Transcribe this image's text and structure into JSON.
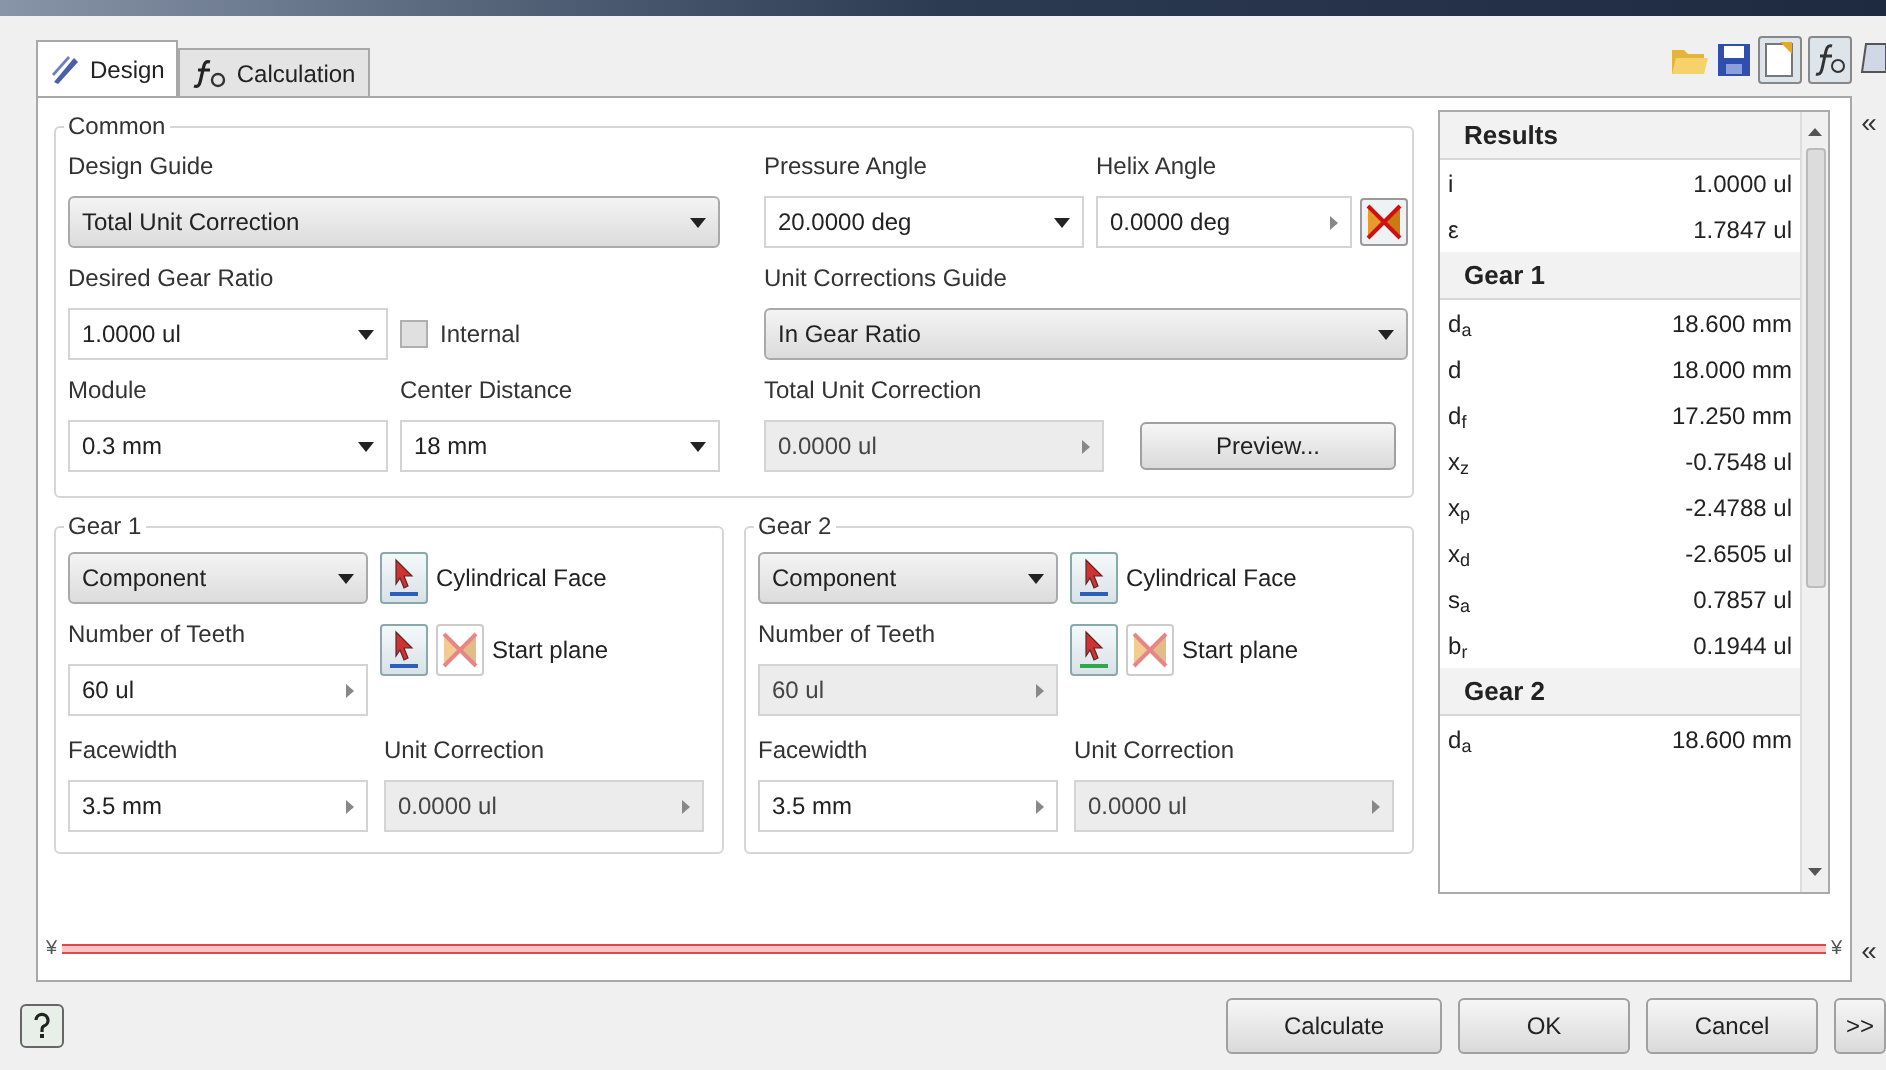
{
  "tabs": [
    {
      "label": "Design",
      "selected": true,
      "kind": "design"
    },
    {
      "label": "Calculation",
      "selected": false,
      "kind": "calc"
    }
  ],
  "common": {
    "title": "Common",
    "design_guide": {
      "label": "Design Guide",
      "value": "Total Unit Correction",
      "kind": "combo"
    },
    "desired_gear_ratio": {
      "label": "Desired Gear Ratio",
      "value": "1.0000 ul",
      "kind": "dropdown"
    },
    "internal": {
      "label": "Internal",
      "checked": false
    },
    "module": {
      "label": "Module",
      "value": "0.3 mm",
      "kind": "dropdown"
    },
    "center_distance": {
      "label": "Center Distance",
      "value": "18 mm",
      "kind": "dropdown"
    },
    "pressure_angle": {
      "label": "Pressure Angle",
      "value": "20.0000 deg",
      "kind": "dropdown"
    },
    "helix_angle": {
      "label": "Helix Angle",
      "value": "0.0000 deg",
      "kind": "spinner",
      "disabled": false
    },
    "unit_corrections_guide": {
      "label": "Unit Corrections Guide",
      "value": "In Gear Ratio",
      "kind": "combo"
    },
    "total_unit_correction": {
      "label": "Total Unit Correction",
      "value": "0.0000 ul",
      "kind": "spinner",
      "disabled": true
    },
    "preview_button": "Preview..."
  },
  "gears": [
    {
      "title": "Gear 1",
      "component": {
        "value": "Component",
        "kind": "combo"
      },
      "cylindrical_face": "Cylindrical Face",
      "start_plane": "Start plane",
      "number_of_teeth": {
        "label": "Number of Teeth",
        "value": "60 ul",
        "kind": "spinner",
        "disabled": false
      },
      "facewidth": {
        "label": "Facewidth",
        "value": "3.5 mm",
        "kind": "spinner",
        "disabled": false
      },
      "unit_correction": {
        "label": "Unit Correction",
        "value": "0.0000 ul",
        "kind": "spinner",
        "disabled": true
      }
    },
    {
      "title": "Gear 2",
      "component": {
        "value": "Component",
        "kind": "combo"
      },
      "cylindrical_face": "Cylindrical Face",
      "start_plane": "Start plane",
      "number_of_teeth": {
        "label": "Number of Teeth",
        "value": "60 ul",
        "kind": "spinner",
        "disabled": true
      },
      "facewidth": {
        "label": "Facewidth",
        "value": "3.5 mm",
        "kind": "spinner",
        "disabled": false
      },
      "unit_correction": {
        "label": "Unit Correction",
        "value": "0.0000 ul",
        "kind": "spinner",
        "disabled": true
      }
    }
  ],
  "results": {
    "title": "Results",
    "rows": [
      {
        "kind": "value",
        "symbol": "i",
        "value": "1.0000 ul"
      },
      {
        "kind": "value",
        "symbol": "ε",
        "value": "1.7847 ul"
      },
      {
        "kind": "header",
        "label": "Gear 1"
      },
      {
        "kind": "value",
        "symbol": "d$_{a}$",
        "value": "18.600 mm"
      },
      {
        "kind": "value",
        "symbol": "d",
        "value": "18.000 mm"
      },
      {
        "kind": "value",
        "symbol": "d$_{f}$",
        "value": "17.250 mm"
      },
      {
        "kind": "value",
        "symbol": "x$_{z}$",
        "value": "-0.7548 ul"
      },
      {
        "kind": "value",
        "symbol": "x$_{p}$",
        "value": "-2.4788 ul"
      },
      {
        "kind": "value",
        "symbol": "x$_{d}$",
        "value": "-2.6505 ul"
      },
      {
        "kind": "value",
        "symbol": "s$_{a}$",
        "value": "0.7857 ul"
      },
      {
        "kind": "value",
        "symbol": "b$_{r}$",
        "value": "0.1944 ul"
      },
      {
        "kind": "header",
        "label": "Gear 2"
      },
      {
        "kind": "value",
        "symbol": "d$_{a}$",
        "value": "18.600 mm"
      }
    ]
  },
  "buttons": [
    "Calculate",
    "OK",
    "Cancel"
  ],
  "more_button": ">>",
  "collapse_glyph": "«",
  "expand_glyph": "¥"
}
